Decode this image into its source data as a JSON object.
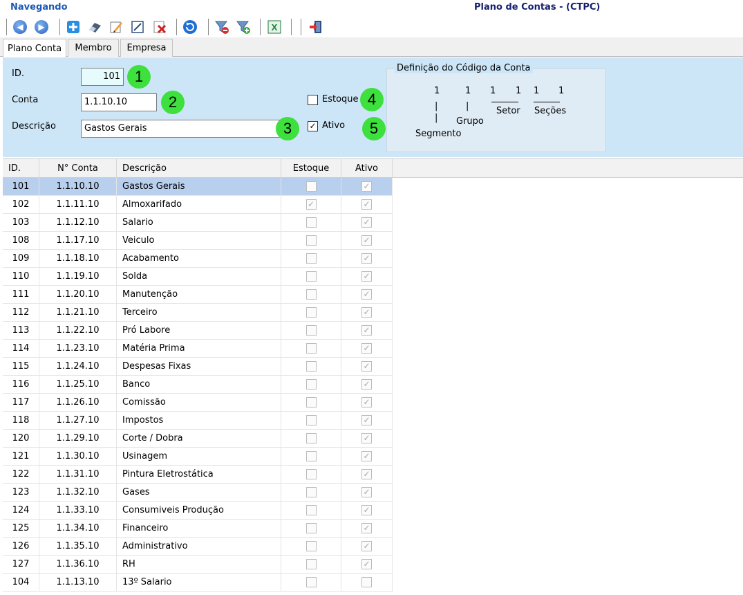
{
  "header": {
    "status": "Navegando",
    "title": "Plano de Contas - (CTPC)"
  },
  "toolbar": {
    "buttons": [
      {
        "icon": "arrow-left-icon"
      },
      {
        "icon": "arrow-right-icon"
      },
      {
        "icon": "plus-icon"
      },
      {
        "icon": "eraser-icon"
      },
      {
        "icon": "pencil-icon"
      },
      {
        "icon": "edit-form-icon"
      },
      {
        "icon": "delete-icon"
      },
      {
        "icon": "refresh-icon"
      },
      {
        "icon": "filter-remove-icon"
      },
      {
        "icon": "filter-add-icon"
      },
      {
        "icon": "excel-icon"
      },
      {
        "icon": "exit-icon"
      }
    ]
  },
  "tabs": [
    "Plano Conta",
    "Membro",
    "Empresa"
  ],
  "form": {
    "id_label": "ID.",
    "id_value": "101",
    "conta_label": "Conta",
    "conta_value": "1.1.10.10",
    "descricao_label": "Descrição",
    "descricao_value": "Gastos Gerais",
    "estoque_label": "Estoque",
    "estoque_checked": false,
    "ativo_label": "Ativo",
    "ativo_checked": true,
    "badges": [
      "1",
      "2",
      "3",
      "4",
      "5"
    ]
  },
  "code_definition": {
    "title": "Definição do Código da Conta",
    "digits": [
      "1",
      "1",
      "1",
      "1",
      "1",
      "1"
    ],
    "bars": [
      "|",
      "|",
      "|"
    ],
    "segmento": "Segmento",
    "grupo": "Grupo",
    "setor": "Setor",
    "secoes": "Seções"
  },
  "grid": {
    "columns": [
      "ID.",
      "N° Conta",
      "Descrição",
      "Estoque",
      "Ativo"
    ],
    "rows": [
      {
        "id": "101",
        "conta": "1.1.10.10",
        "descricao": "Gastos Gerais",
        "estoque": false,
        "ativo": true
      },
      {
        "id": "102",
        "conta": "1.1.11.10",
        "descricao": "Almoxarifado",
        "estoque": true,
        "ativo": true
      },
      {
        "id": "103",
        "conta": "1.1.12.10",
        "descricao": "Salario",
        "estoque": false,
        "ativo": true
      },
      {
        "id": "108",
        "conta": "1.1.17.10",
        "descricao": "Veiculo",
        "estoque": false,
        "ativo": true
      },
      {
        "id": "109",
        "conta": "1.1.18.10",
        "descricao": "Acabamento",
        "estoque": false,
        "ativo": true
      },
      {
        "id": "110",
        "conta": "1.1.19.10",
        "descricao": "Solda",
        "estoque": false,
        "ativo": true
      },
      {
        "id": "111",
        "conta": "1.1.20.10",
        "descricao": "Manutenção",
        "estoque": false,
        "ativo": true
      },
      {
        "id": "112",
        "conta": "1.1.21.10",
        "descricao": "Terceiro",
        "estoque": false,
        "ativo": true
      },
      {
        "id": "113",
        "conta": "1.1.22.10",
        "descricao": "Pró Labore",
        "estoque": false,
        "ativo": true
      },
      {
        "id": "114",
        "conta": "1.1.23.10",
        "descricao": "Matéria Prima",
        "estoque": false,
        "ativo": true
      },
      {
        "id": "115",
        "conta": "1.1.24.10",
        "descricao": "Despesas Fixas",
        "estoque": false,
        "ativo": true
      },
      {
        "id": "116",
        "conta": "1.1.25.10",
        "descricao": "Banco",
        "estoque": false,
        "ativo": true
      },
      {
        "id": "117",
        "conta": "1.1.26.10",
        "descricao": "Comissão",
        "estoque": false,
        "ativo": true
      },
      {
        "id": "118",
        "conta": "1.1.27.10",
        "descricao": "Impostos",
        "estoque": false,
        "ativo": true
      },
      {
        "id": "120",
        "conta": "1.1.29.10",
        "descricao": "Corte / Dobra",
        "estoque": false,
        "ativo": true
      },
      {
        "id": "121",
        "conta": "1.1.30.10",
        "descricao": "Usinagem",
        "estoque": false,
        "ativo": true
      },
      {
        "id": "122",
        "conta": "1.1.31.10",
        "descricao": "Pintura Eletrostática",
        "estoque": false,
        "ativo": true
      },
      {
        "id": "123",
        "conta": "1.1.32.10",
        "descricao": "Gases",
        "estoque": false,
        "ativo": true
      },
      {
        "id": "124",
        "conta": "1.1.33.10",
        "descricao": "Consumiveis Produção",
        "estoque": false,
        "ativo": true
      },
      {
        "id": "125",
        "conta": "1.1.34.10",
        "descricao": "Financeiro",
        "estoque": false,
        "ativo": true
      },
      {
        "id": "126",
        "conta": "1.1.35.10",
        "descricao": "Administrativo",
        "estoque": false,
        "ativo": true
      },
      {
        "id": "127",
        "conta": "1.1.36.10",
        "descricao": "RH",
        "estoque": false,
        "ativo": true
      },
      {
        "id": "104",
        "conta": "1.1.13.10",
        "descricao": "13º Salario",
        "estoque": false,
        "ativo": false
      }
    ]
  },
  "colors": {
    "status_text": "#1c57b5",
    "title_text": "#14206e",
    "form_background": "#cde6f7",
    "selected_row": "#b9cfee",
    "badge": "#3de03d"
  }
}
